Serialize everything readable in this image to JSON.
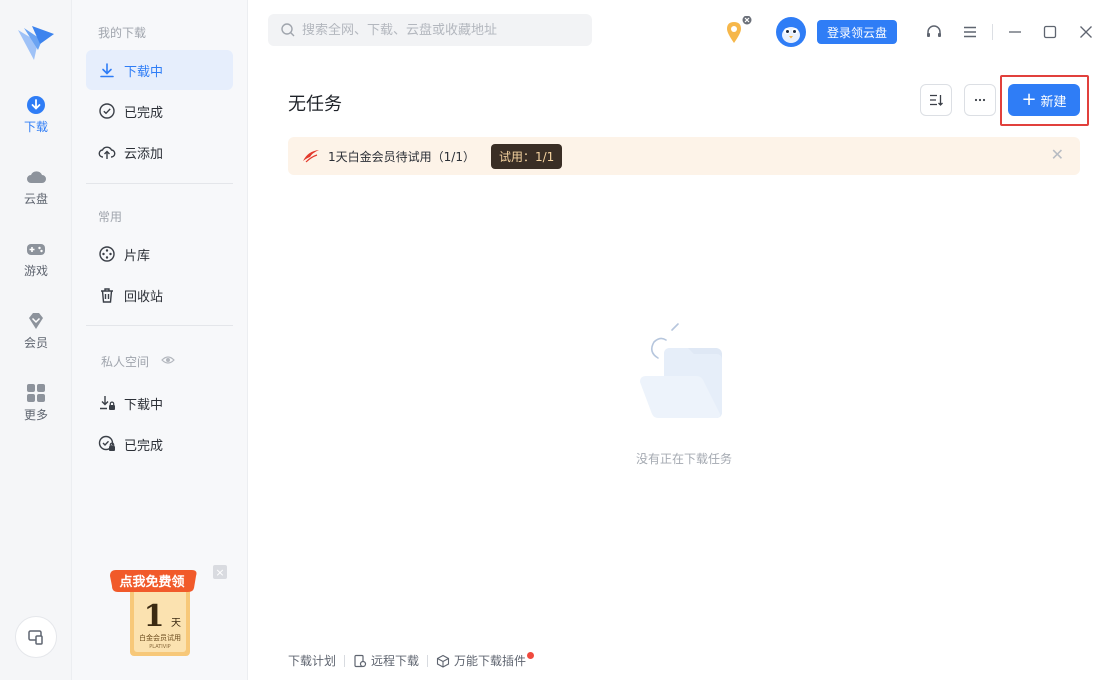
{
  "rail": {
    "items": [
      {
        "label": "下载"
      },
      {
        "label": "云盘"
      },
      {
        "label": "游戏"
      },
      {
        "label": "会员"
      },
      {
        "label": "更多"
      }
    ]
  },
  "sidebar": {
    "my_downloads_title": "我的下载",
    "items": [
      {
        "label": "下载中"
      },
      {
        "label": "已完成"
      },
      {
        "label": "云添加"
      }
    ],
    "common_title": "常用",
    "common_items": [
      {
        "label": "片库"
      },
      {
        "label": "回收站"
      }
    ],
    "private_title": "私人空间",
    "private_items": [
      {
        "label": "下载中"
      },
      {
        "label": "已完成"
      }
    ],
    "promo": {
      "ribbon": "点我免费领",
      "big": "1",
      "unit": "天",
      "line1": "白金会员试用",
      "line2": "PLATIVIP"
    }
  },
  "search": {
    "placeholder": "搜索全网、下载、云盘或收藏地址"
  },
  "header": {
    "login_label": "登录领云盘"
  },
  "main": {
    "title": "无任务",
    "new_label": "新建",
    "banner_text": "1天白金会员待试用（1/1）",
    "banner_tag": "试用：1/1",
    "empty_text": "没有正在下载任务"
  },
  "footer": {
    "items": [
      {
        "label": "下载计划"
      },
      {
        "label": "远程下载"
      },
      {
        "label": "万能下载插件"
      }
    ]
  },
  "colors": {
    "accent": "#2f7df6",
    "highlight_border": "#e1403c",
    "banner_bg": "#fdf3e8"
  }
}
